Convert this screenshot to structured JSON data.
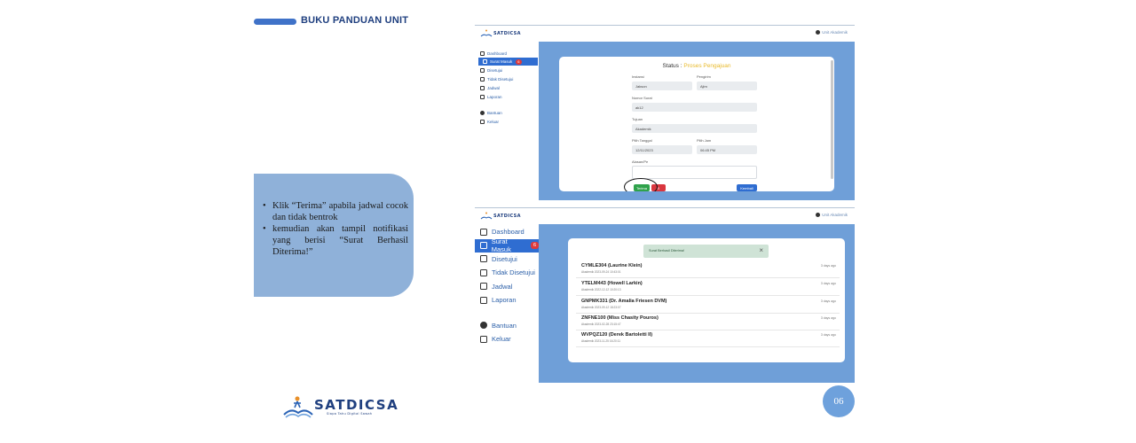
{
  "header": {
    "title": "BUKU PANDUAN UNIT"
  },
  "instructions": [
    "Klik “Terima” apabila jadwal cocok dan tidak bentrok",
    "kemudian akan tampil notifikasi yang berisi “Surat Berhasil Diterima!”"
  ],
  "footer": {
    "brand": "SATDICSA",
    "tagline": "Siapa Tahu Digital Sawah",
    "page_number": "06"
  },
  "app": {
    "brand": "SATDICSA",
    "user": "Unit Akademik",
    "sidebar": [
      {
        "label": "Dashboard",
        "icon": "dashboard-icon"
      },
      {
        "label": "Surat Masuk",
        "icon": "inbox-icon",
        "badge": "6",
        "active": true
      },
      {
        "label": "Disetujui",
        "icon": "check-doc-icon"
      },
      {
        "label": "Tidak Disetujui",
        "icon": "reject-doc-icon"
      },
      {
        "label": "Jadwal",
        "icon": "calendar-icon"
      },
      {
        "label": "Laporan",
        "icon": "report-icon"
      }
    ],
    "sidebar_bottom": [
      {
        "label": "Bantuan",
        "icon": "help-icon"
      },
      {
        "label": "Keluar",
        "icon": "logout-icon"
      }
    ]
  },
  "status_form": {
    "title_label": "Status :",
    "title_value": "Proses Pengajuan",
    "instansi_label": "Instansi",
    "instansi_value": "Jakson",
    "pengirim_label": "Pengirim",
    "pengirim_value": "Ajim",
    "nomor_label": "Nomor Surat",
    "nomor_value": "ak12",
    "tujuan_label": "Tujuan",
    "tujuan_value": "Akademik",
    "tanggal_label": "Pilih Tanggal",
    "tanggal_value": "12/11/2023",
    "jam_label": "Pilih Jam",
    "jam_value": "06:45 PM",
    "alasan_label": "Alasan/Pe",
    "btn_terima": "Terima",
    "btn_tolak": "X",
    "btn_kembali": "Kembali"
  },
  "notification": {
    "text": "Surat Berhasil Diterima!",
    "close": "×"
  },
  "letters": [
    {
      "title": "CYMLE304 (Laurine Klein)",
      "sub": "Akademik 2023-09-24 10:43:01",
      "ago": "3 days ago"
    },
    {
      "title": "YTELM443 (Howell Larkin)",
      "sub": "Akademik 2022-12-12 10:20:13",
      "ago": "3 days ago"
    },
    {
      "title": "GNPMK331 (Dr. Amalia Friesen DVM)",
      "sub": "Akademik 2023-09-12 18:23:07",
      "ago": "3 days ago"
    },
    {
      "title": "ZNFNE100 (Miss Chasity Pouros)",
      "sub": "Akademik 2023-02-28 23:15:47",
      "ago": "3 days ago"
    },
    {
      "title": "WVPQZ120 (Derek Bartoletti II)",
      "sub": "Akademik 2023-11-25 16:20:11",
      "ago": "3 days ago"
    }
  ]
}
